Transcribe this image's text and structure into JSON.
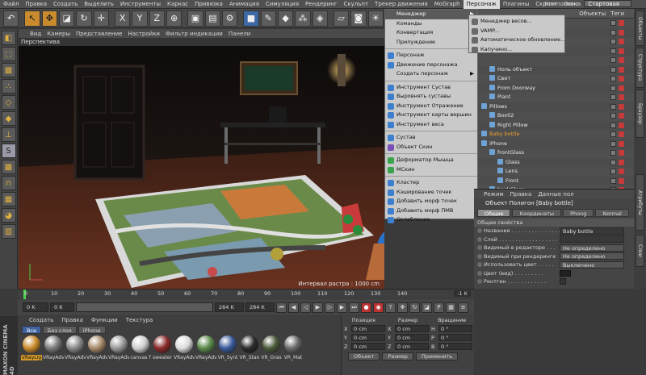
{
  "menubar": {
    "items": [
      "Файл",
      "Правка",
      "Создать",
      "Выделить",
      "Инструменты",
      "Каркас",
      "Привязка",
      "Анимация",
      "Симуляция",
      "Рендеринг",
      "Скульпт",
      "Трекер движения",
      "MoGraph",
      "Персонаж",
      "Плагины",
      "Скрипт",
      "Окно",
      "Справка"
    ],
    "active_item": "Персонаж",
    "layout_label": "Компоновка",
    "layout_value": "Стартовая"
  },
  "toolbar": {
    "icons": [
      "undo-icon",
      "select-icon",
      "move-icon",
      "scale-icon",
      "rotate-icon",
      "add-icon",
      "x-axis-icon",
      "y-axis-icon",
      "z-axis-icon",
      "coord-icon",
      "render-view-icon",
      "render-picture-icon",
      "render-settings-icon",
      "cube-icon",
      "pen-icon",
      "subdivision-icon",
      "array-icon",
      "deformer-icon",
      "floor-icon",
      "camera-icon",
      "light-icon"
    ],
    "axis_labels": [
      "X",
      "Y",
      "Z"
    ]
  },
  "viewport": {
    "menu": [
      "Вид",
      "Камеры",
      "Представление",
      "Настройки",
      "Фильтр индикации",
      "Панели"
    ],
    "label": "Перспектива",
    "status": "Интервал растра : 1000 cm"
  },
  "character_menu": {
    "items": [
      {
        "label": "Менеджер",
        "submenu": true,
        "highlight": true
      },
      {
        "label": "Команды",
        "submenu": true
      },
      {
        "label": "Конвертация",
        "submenu": true
      },
      {
        "label": "Прилуждение",
        "submenu": true
      },
      {
        "sep": true
      },
      {
        "label": "Персонаж",
        "icon": "#3d7fcf"
      },
      {
        "label": "Движение персонажа",
        "icon": "#3d7fcf"
      },
      {
        "label": "Создать персонаж",
        "submenu": true
      },
      {
        "sep": true
      },
      {
        "label": "Инструмент Сустав",
        "icon": "#3d7fcf"
      },
      {
        "label": "Выровнять суставы",
        "icon": "#3d7fcf"
      },
      {
        "label": "Инструмент Отражение",
        "icon": "#3d7fcf"
      },
      {
        "label": "Инструмент карты вершин",
        "icon": "#3d7fcf"
      },
      {
        "label": "Инструмент веса",
        "icon": "#3d7fcf"
      },
      {
        "sep": true
      },
      {
        "label": "Сустав",
        "icon": "#3d7fcf"
      },
      {
        "label": "Объект Скин",
        "icon": "#7a4fb6"
      },
      {
        "sep": true
      },
      {
        "label": "Деформатор Мышца",
        "icon": "#3aa34d"
      },
      {
        "label": "MСкин",
        "icon": "#3aa34d"
      },
      {
        "sep": true
      },
      {
        "label": "Кластер",
        "icon": "#3d7fcf"
      },
      {
        "label": "Кэширование точек",
        "icon": "#3d7fcf"
      },
      {
        "label": "Добавить морф точек",
        "icon": "#3d7fcf"
      },
      {
        "label": "Добавить морф ПМВ",
        "icon": "#3d7fcf"
      },
      {
        "label": "Ослабление",
        "icon": "#3d7fcf"
      }
    ]
  },
  "manager_submenu": {
    "items": [
      "Менеджер весов...",
      "VAMP...",
      "Автоматическое обновление...",
      "Капучино..."
    ]
  },
  "object_manager": {
    "header": [
      "Объекты",
      "Теги"
    ],
    "rows": [
      {
        "label": "",
        "indent": 0
      },
      {
        "label": "",
        "indent": 0
      },
      {
        "label": "",
        "indent": 0
      },
      {
        "label": "",
        "indent": 0
      },
      {
        "label": "",
        "indent": 0
      },
      {
        "label": "Ноль объект",
        "indent": 1
      },
      {
        "label": "Свет",
        "indent": 1
      },
      {
        "label": "From Doorway",
        "indent": 1
      },
      {
        "label": "Plant",
        "indent": 1
      },
      {
        "label": "Pillows",
        "indent": 0
      },
      {
        "label": "Box02",
        "indent": 1
      },
      {
        "label": "Right Pillow",
        "indent": 1
      },
      {
        "label": "Baby bottle",
        "indent": 0,
        "selected": true
      },
      {
        "label": "iPhone",
        "indent": 0
      },
      {
        "label": "frontGlass",
        "indent": 1
      },
      {
        "label": "Glass",
        "indent": 2
      },
      {
        "label": "Lens",
        "indent": 2
      },
      {
        "label": "Front",
        "indent": 2
      },
      {
        "label": "backGlass",
        "indent": 1
      }
    ]
  },
  "right_tabs": [
    "Объекты",
    "Структура",
    "Браузер",
    "Атрибуты",
    "Слои"
  ],
  "attributes": {
    "menu": [
      "Режим",
      "Правка",
      "Данные пол"
    ],
    "title": "Объект Полигон [Baby bottle]",
    "tabs": [
      "Общие",
      "Координаты",
      "Phong",
      "Normal"
    ],
    "active_tab": "Общие",
    "section": "Общие свойства",
    "props": [
      {
        "label": "Название . . . . . . . . . . . . . . .",
        "value": "Baby bottle",
        "type": "text"
      },
      {
        "label": "Слой . . . . . . . . . . . . . . . . . .",
        "value": "",
        "type": "text"
      },
      {
        "label": "Видимый в редакторе . . .",
        "value": "Не определено",
        "type": "dd"
      },
      {
        "label": "Видимый при рендеринге",
        "value": "Не определено",
        "type": "dd"
      },
      {
        "label": "Использовать цвет . . . . .",
        "value": "Выключено",
        "type": "dd"
      },
      {
        "label": "Цвет (вид) . . . . . . . . .",
        "value": "",
        "type": "swatch"
      },
      {
        "label": "Рентген . . . . . . . . . . . .",
        "value": "",
        "type": "check"
      }
    ]
  },
  "timeline": {
    "ticks": [
      "0",
      "10",
      "20",
      "30",
      "40",
      "50",
      "60",
      "70",
      "80",
      "90",
      "100",
      "110",
      "120",
      "130",
      "140"
    ],
    "right_field": "-1 K"
  },
  "transport": {
    "start": "0 K",
    "min": "0 K",
    "max": "284 K",
    "end": "284 K"
  },
  "materials": {
    "menu": [
      "Создать",
      "Правка",
      "Функции",
      "Текстура"
    ],
    "filters": [
      "Все",
      "Без слоя",
      "iPhone"
    ],
    "active_filter": "Все",
    "items": [
      {
        "label": "VRayLig",
        "color": "#c98a2a",
        "selected": true
      },
      {
        "label": "VRayAdv",
        "color": "#7a7a7a"
      },
      {
        "label": "VRayAdv",
        "color": "#8a8a8a"
      },
      {
        "label": "VRayAdv",
        "color": "#a68a6a"
      },
      {
        "label": "VRayAdv",
        "color": "#9a9a9a"
      },
      {
        "label": "canvas f",
        "color": "#cfcfcf"
      },
      {
        "label": "sweater",
        "color": "#8a2a2a"
      },
      {
        "label": "VRayAdv",
        "color": "#dcdcdc"
      },
      {
        "label": "VRayAdv",
        "color": "#5a8a4a"
      },
      {
        "label": "VR_Synt",
        "color": "#3a5a9a"
      },
      {
        "label": "VR_Stan",
        "color": "#2a2a2a"
      },
      {
        "label": "VR_Gras",
        "color": "#4a5a3a"
      },
      {
        "label": "VR_Mat",
        "color": "#6a6a6a"
      }
    ]
  },
  "coordinates": {
    "headers": [
      "Позиция",
      "Размер",
      "Вращение"
    ],
    "rows": [
      {
        "axis": "X",
        "pos": "0 cm",
        "size": "0 cm",
        "rot_axis": "H",
        "rot": "0 °"
      },
      {
        "axis": "Y",
        "pos": "0 cm",
        "size": "0 cm",
        "rot_axis": "P",
        "rot": "0 °"
      },
      {
        "axis": "Z",
        "pos": "0 cm",
        "size": "0 cm",
        "rot_axis": "B",
        "rot": "0 °"
      }
    ],
    "mode": "Объект",
    "size_mode": "Размер",
    "apply": "Применить"
  },
  "branding": "MAXON CINEMA 4D"
}
